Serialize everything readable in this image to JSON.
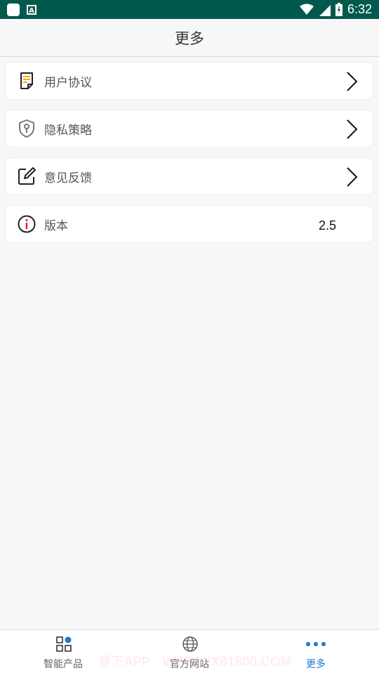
{
  "status_bar": {
    "time": "6:32"
  },
  "header": {
    "title": "更多"
  },
  "menu": {
    "items": [
      {
        "label": "用户协议",
        "icon": "document-icon"
      },
      {
        "label": "隐私策略",
        "icon": "shield-icon"
      },
      {
        "label": "意见反馈",
        "icon": "edit-icon"
      },
      {
        "label": "版本",
        "icon": "info-icon",
        "value": "2.5"
      }
    ]
  },
  "tabbar": {
    "tabs": [
      {
        "label": "智能产品",
        "icon": "grid-icon",
        "active": false
      },
      {
        "label": "官方网站",
        "icon": "globe-icon",
        "active": false
      },
      {
        "label": "更多",
        "icon": "more-dots-icon",
        "active": true
      }
    ]
  },
  "watermark": {
    "text": "易下APP · WWW.YX81800.COM"
  },
  "colors": {
    "status_bar": "#00594c",
    "accent": "#1a7ad0",
    "icon_orange": "#f5a623"
  }
}
